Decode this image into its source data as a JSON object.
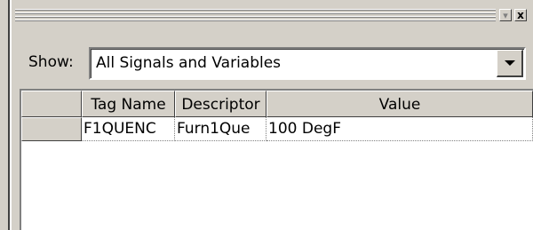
{
  "titlebar": {
    "pin_icon": "pin-icon",
    "close_icon": "close-icon",
    "close_glyph": "x"
  },
  "filter": {
    "label": "Show:",
    "selected": "All Signals and Variables"
  },
  "grid": {
    "columns": [
      "",
      "Tag Name",
      "Descriptor",
      "Value"
    ],
    "rows": [
      {
        "tag_name": "F1QUENC",
        "descriptor": "Furn1Que",
        "value": "100 DegF"
      }
    ]
  }
}
